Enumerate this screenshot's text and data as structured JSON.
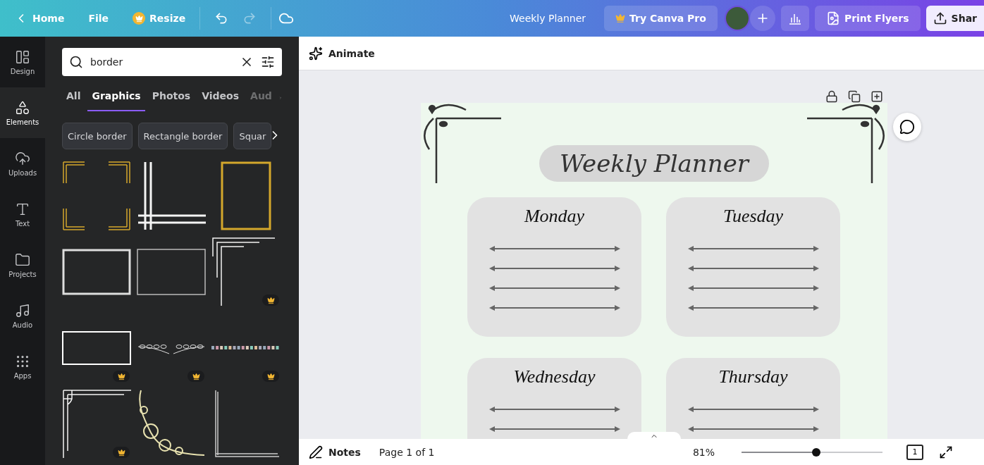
{
  "topbar": {
    "home": "Home",
    "file": "File",
    "resize": "Resize",
    "undo": {
      "disabled": false
    },
    "redo": {
      "disabled": true
    },
    "title": "Weekly Planner",
    "pro": "Try Canva Pro",
    "print": "Print Flyers",
    "share": "Shar"
  },
  "rail": [
    {
      "label": "Design",
      "selected": false
    },
    {
      "label": "Elements",
      "selected": true
    },
    {
      "label": "Uploads",
      "selected": false
    },
    {
      "label": "Text",
      "selected": false
    },
    {
      "label": "Projects",
      "selected": false
    },
    {
      "label": "Audio",
      "selected": false
    },
    {
      "label": "Apps",
      "selected": false
    }
  ],
  "search": {
    "value": "border"
  },
  "tabs": [
    {
      "label": "All",
      "selected": false
    },
    {
      "label": "Graphics",
      "selected": true
    },
    {
      "label": "Photos",
      "selected": false
    },
    {
      "label": "Videos",
      "selected": false
    },
    {
      "label": "Aud",
      "selected": false
    }
  ],
  "chips": [
    "Circle border",
    "Rectangle border",
    "Squar"
  ],
  "graphics": [
    {
      "kind": "gold-corners",
      "premium": false
    },
    {
      "kind": "double-lines",
      "premium": false
    },
    {
      "kind": "gold-frame",
      "premium": false
    },
    {
      "kind": "thick-rect",
      "premium": false
    },
    {
      "kind": "thin-rect",
      "premium": false
    },
    {
      "kind": "corner-lines",
      "premium": true
    },
    {
      "kind": "white-rect",
      "premium": true
    },
    {
      "kind": "laurel",
      "premium": true
    },
    {
      "kind": "dots",
      "premium": true
    },
    {
      "kind": "ornate-corner",
      "premium": true
    },
    {
      "kind": "floral-corner",
      "premium": false
    },
    {
      "kind": "sketch-corner",
      "premium": false
    }
  ],
  "toolbar": {
    "animate": "Animate"
  },
  "planner": {
    "title": "Weekly Planner",
    "days": [
      "Monday",
      "Tuesday",
      "Wednesday",
      "Thursday"
    ]
  },
  "bottombar": {
    "notes": "Notes",
    "page": "Page 1 of 1",
    "zoom": "81%",
    "level": 0.53,
    "pages": "1"
  }
}
